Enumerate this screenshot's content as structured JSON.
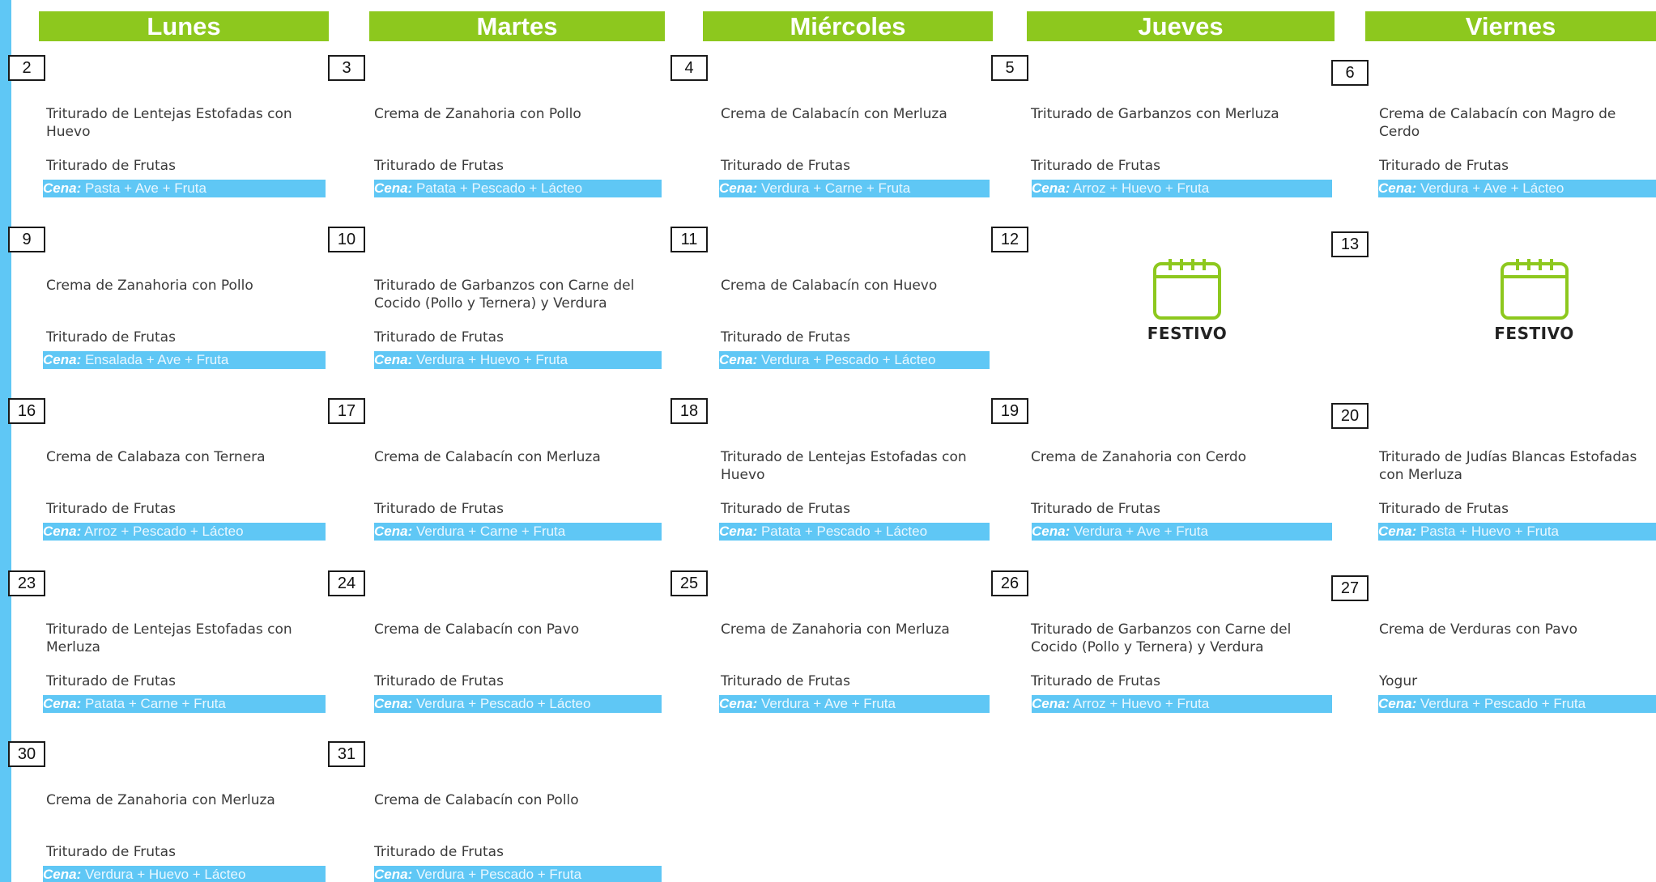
{
  "days": [
    "Lunes",
    "Martes",
    "Miércoles",
    "Jueves",
    "Viernes"
  ],
  "cena_label": "Cena:",
  "festivo_label": "FESTIVO",
  "weeks": [
    [
      {
        "date": "2",
        "main": "Triturado de Lentejas Estofadas con Huevo",
        "dessert": "Triturado de Frutas",
        "cena": "Pasta + Ave + Fruta"
      },
      {
        "date": "3",
        "main": "Crema de Zanahoria con Pollo",
        "dessert": "Triturado de Frutas",
        "cena": "Patata + Pescado + Lácteo"
      },
      {
        "date": "4",
        "main": "Crema de Calabacín con Merluza",
        "dessert": "Triturado de Frutas",
        "cena": "Verdura + Carne + Fruta"
      },
      {
        "date": "5",
        "main": "Triturado de Garbanzos con Merluza",
        "dessert": "Triturado de Frutas",
        "cena": "Arroz + Huevo + Fruta"
      },
      {
        "date": "6",
        "main": "Crema de Calabacín con Magro de Cerdo",
        "dessert": "Triturado de Frutas",
        "cena": "Verdura + Ave + Lácteo"
      }
    ],
    [
      {
        "date": "9",
        "main": "Crema de Zanahoria con Pollo",
        "dessert": "Triturado de Frutas",
        "cena": "Ensalada + Ave + Fruta"
      },
      {
        "date": "10",
        "main": "Triturado de Garbanzos con Carne del Cocido (Pollo y Ternera) y Verdura",
        "dessert": "Triturado de Frutas",
        "cena": "Verdura + Huevo + Fruta"
      },
      {
        "date": "11",
        "main": "Crema de Calabacín con Huevo",
        "dessert": "Triturado de Frutas",
        "cena": "Verdura + Pescado + Lácteo"
      },
      {
        "date": "12",
        "festivo": true
      },
      {
        "date": "13",
        "festivo": true
      }
    ],
    [
      {
        "date": "16",
        "main": "Crema de Calabaza con Ternera",
        "dessert": "Triturado de Frutas",
        "cena": "Arroz + Pescado + Lácteo"
      },
      {
        "date": "17",
        "main": "Crema de Calabacín con Merluza",
        "dessert": "Triturado de Frutas",
        "cena": "Verdura + Carne + Fruta"
      },
      {
        "date": "18",
        "main": "Triturado de Lentejas Estofadas con Huevo",
        "dessert": "Triturado de Frutas",
        "cena": "Patata + Pescado + Lácteo"
      },
      {
        "date": "19",
        "main": "Crema de Zanahoria con Cerdo",
        "dessert": "Triturado de Frutas",
        "cena": "Verdura + Ave + Fruta"
      },
      {
        "date": "20",
        "main": "Triturado de Judías Blancas Estofadas con Merluza",
        "dessert": "Triturado de Frutas",
        "cena": "Pasta + Huevo + Fruta"
      }
    ],
    [
      {
        "date": "23",
        "main": "Triturado de Lentejas Estofadas con Merluza",
        "dessert": "Triturado de Frutas",
        "cena": "Patata + Carne + Fruta"
      },
      {
        "date": "24",
        "main": "Crema de Calabacín con Pavo",
        "dessert": "Triturado de Frutas",
        "cena": "Verdura + Pescado + Lácteo"
      },
      {
        "date": "25",
        "main": "Crema de Zanahoria con Merluza",
        "dessert": "Triturado de Frutas",
        "cena": "Verdura + Ave + Fruta"
      },
      {
        "date": "26",
        "main": "Triturado de Garbanzos con Carne del Cocido (Pollo y Ternera) y Verdura",
        "dessert": "Triturado de Frutas",
        "cena": "Arroz + Huevo + Fruta"
      },
      {
        "date": "27",
        "main": "Crema de Verduras con Pavo",
        "dessert": "Yogur",
        "cena": "Verdura + Pescado + Fruta"
      }
    ],
    [
      {
        "date": "30",
        "main": "Crema de Zanahoria con Merluza",
        "dessert": "Triturado de Frutas",
        "cena": "Verdura + Huevo + Lácteo"
      },
      {
        "date": "31",
        "main": "Crema de Calabacín con Pollo",
        "dessert": "Triturado de Frutas",
        "cena": "Verdura + Pescado + Fruta"
      }
    ]
  ],
  "colors": {
    "header_green": "#8dc81e",
    "cena_blue": "#5fc7f5"
  }
}
